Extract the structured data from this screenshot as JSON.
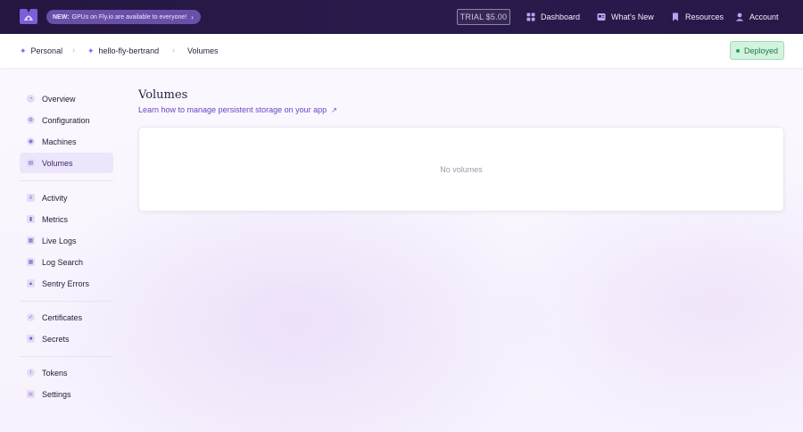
{
  "topbar": {
    "promo": {
      "tag": "NEW:",
      "text": "GPUs on Fly.io are available to everyone!",
      "chevron": "›"
    },
    "trial": "TRIAL $5.00",
    "links": [
      {
        "label": "Dashboard",
        "icon": "dashboard-icon"
      },
      {
        "label": "What's New",
        "icon": "news-icon"
      },
      {
        "label": "Resources",
        "icon": "bookmark-icon"
      },
      {
        "label": "Account",
        "icon": "user-icon"
      }
    ]
  },
  "breadcrumb": {
    "items": [
      {
        "label": "Personal"
      },
      {
        "label": "hello-fly-bertrand"
      },
      {
        "label": "Volumes"
      }
    ],
    "separator": "›"
  },
  "status": {
    "label": "Deployed",
    "color": "#22a45a"
  },
  "sidebar": {
    "items": [
      {
        "label": "Overview",
        "icon": "overview-icon"
      },
      {
        "label": "Configuration",
        "icon": "gear-icon"
      },
      {
        "label": "Machines",
        "icon": "machine-icon"
      },
      {
        "label": "Volumes",
        "icon": "volume-icon",
        "active": true
      },
      {
        "label": "Activity",
        "icon": "activity-icon"
      },
      {
        "label": "Metrics",
        "icon": "metrics-icon"
      },
      {
        "label": "Live Logs",
        "icon": "logs-icon"
      },
      {
        "label": "Log Search",
        "icon": "log-search-icon"
      },
      {
        "label": "Sentry Errors",
        "icon": "sentry-icon"
      },
      {
        "label": "Certificates",
        "icon": "certificate-icon"
      },
      {
        "label": "Secrets",
        "icon": "lock-icon"
      },
      {
        "label": "Tokens",
        "icon": "token-icon"
      },
      {
        "label": "Settings",
        "icon": "settings-icon"
      }
    ]
  },
  "main": {
    "title": "Volumes",
    "link": "Learn how to manage persistent storage on your app",
    "empty_message": "No volumes"
  },
  "colors": {
    "accent": "#6a44c8",
    "topbar": "#241640",
    "active_bg": "#ede5fb"
  }
}
